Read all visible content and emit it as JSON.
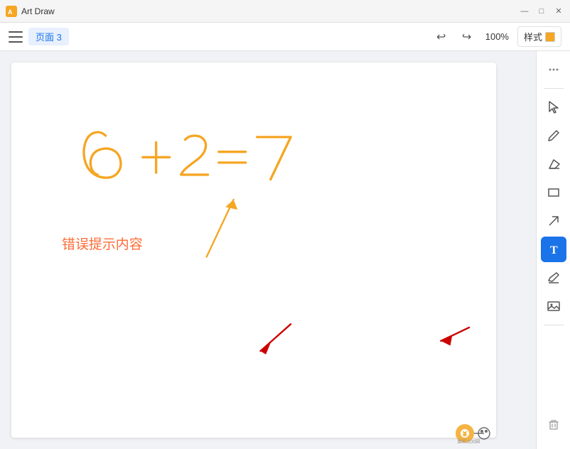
{
  "titlebar": {
    "app_name": "Art Draw",
    "minimize": "—",
    "maximize": "□",
    "close": "✕"
  },
  "toolbar": {
    "menu_label": "menu",
    "page_badge": "页面 3",
    "undo_label": "↩",
    "redo_label": "↪",
    "zoom": "100%",
    "style_label": "样式"
  },
  "right_toolbar": {
    "more_btn": "⋯",
    "select_btn": "▲",
    "pen_btn": "✏",
    "eraser_btn": "◇",
    "rect_btn": "□",
    "arrow_btn": "↗",
    "text_btn": "T",
    "sign_btn": "✏",
    "image_btn": "🖼",
    "delete_btn": "🗑"
  },
  "canvas": {
    "error_text": "错误提示内容"
  },
  "colors": {
    "orange": "#F5A623",
    "red_arrow": "#CC0000",
    "blue_active": "#1a73e8",
    "style_box": "#F5A623"
  }
}
